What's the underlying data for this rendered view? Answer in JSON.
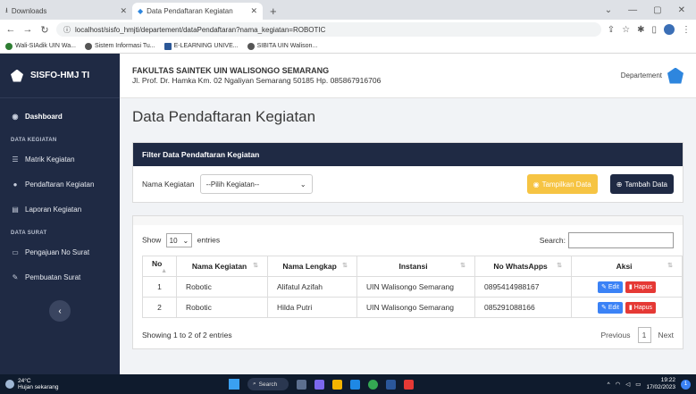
{
  "browser": {
    "tabs": [
      {
        "label": "Downloads",
        "active": false
      },
      {
        "label": "Data Pendaftaran Kegiatan",
        "active": true
      }
    ],
    "url": "localhost/sisfo_hmjti/departement/dataPendaftaran?nama_kegiatan=ROBOTIC",
    "bookmarks": [
      "Wali-SIAdik UIN Wa...",
      "Sistem Informasi Tu...",
      "E-LEARNING UNIVE...",
      "SIBITA UIN Walison..."
    ]
  },
  "sidebar": {
    "brand": "SISFO-HMJ TI",
    "dashboard": "Dashboard",
    "section1": "DATA KEGIATAN",
    "items1": [
      "Matrik Kegiatan",
      "Pendaftaran Kegiatan",
      "Laporan Kegiatan"
    ],
    "section2": "DATA SURAT",
    "items2": [
      "Pengajuan No Surat",
      "Pembuatan Surat"
    ]
  },
  "header": {
    "org_name": "FAKULTAS SAINTEK UIN WALISONGO SEMARANG",
    "org_address": "Jl. Prof. Dr. Hamka Km. 02 Ngaliyan Semarang 50185 Hp. 085867916706",
    "dept_label": "Departement"
  },
  "page": {
    "title": "Data Pendaftaran Kegiatan",
    "filter_title": "Filter Data Pendaftaran Kegiatan",
    "filter_label": "Nama Kegiatan",
    "select_placeholder": "--Pilih Kegiatan--",
    "btn_show": "Tampilkan Data",
    "btn_add": "Tambah Data"
  },
  "table": {
    "show_label": "Show",
    "entries_value": "10",
    "entries_label": "entries",
    "search_label": "Search:",
    "columns": [
      "No",
      "Nama Kegiatan",
      "Nama Lengkap",
      "Instansi",
      "No WhatsApps",
      "Aksi"
    ],
    "rows": [
      {
        "no": "1",
        "kegiatan": "Robotic",
        "nama": "Alifatul Azifah",
        "instansi": "UIN Walisongo Semarang",
        "wa": "0895414988167"
      },
      {
        "no": "2",
        "kegiatan": "Robotic",
        "nama": "Hilda Putri",
        "instansi": "UIN Walisongo Semarang",
        "wa": "085291088166"
      }
    ],
    "edit_label": "Edit",
    "delete_label": "Hapus",
    "info": "Showing 1 to 2 of 2 entries",
    "prev": "Previous",
    "page": "1",
    "next": "Next"
  },
  "taskbar": {
    "temp": "24°C",
    "weather": "Hujan sekarang",
    "search": "Search",
    "time": "19:22",
    "date": "17/02/2023",
    "notif": "1"
  },
  "colors": {
    "navy": "#1f2a44",
    "warning": "#f6c443",
    "edit": "#3b82f6",
    "delete": "#e53935"
  }
}
